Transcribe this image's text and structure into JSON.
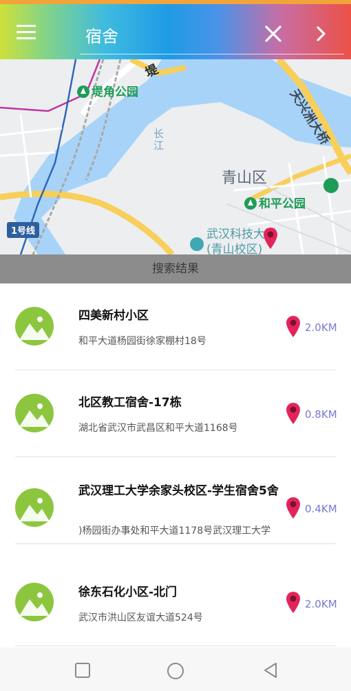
{
  "search": {
    "query": "宿舍"
  },
  "map": {
    "parks": [
      "堤角公园",
      "和平公园"
    ],
    "district": "青山区",
    "river": "长江",
    "school": [
      "武汉科技大学",
      "(青山校区)"
    ],
    "bridge": "天兴洲大桥",
    "metro_line": "1号线",
    "road_fragment": "堤"
  },
  "results_header": "搜索结果",
  "results": [
    {
      "name": "四美新村小区",
      "address": "和平大道杨园街徐家棚村18号",
      "distance": "2.0KM"
    },
    {
      "name": "北区教工宿舍-17栋",
      "address": "湖北省武汉市武昌区和平大道1168号",
      "distance": "0.8KM"
    },
    {
      "name": "武汉理工大学余家头校区-学生宿舍5舍",
      "address": "杨园街办事处和平大道1178号武汉理工大学(",
      "distance": "0.4KM"
    },
    {
      "name": "徐东石化小区-北门",
      "address": "武汉市洪山区友谊大道524号",
      "distance": "2.0KM"
    }
  ],
  "colors": {
    "accent_green": "#8cc63f",
    "pin_red": "#e3245a",
    "distance_purple": "#7b77d2"
  }
}
